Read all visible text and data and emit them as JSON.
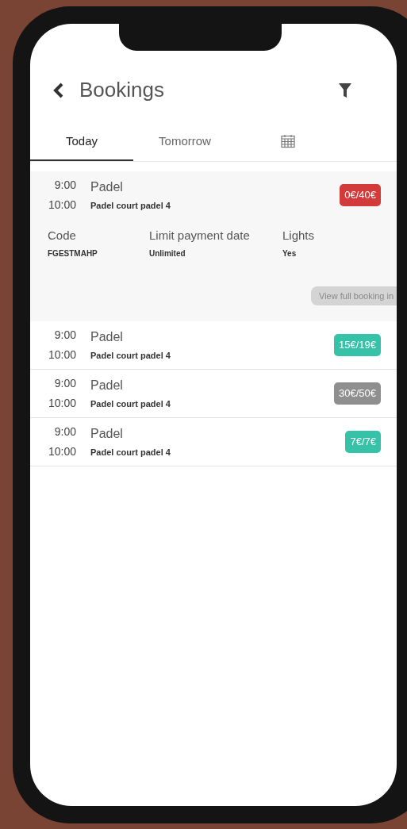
{
  "header": {
    "title": "Bookings"
  },
  "tabs": [
    {
      "kind": "text",
      "label": "Today",
      "selected": true
    },
    {
      "kind": "text",
      "label": "Tomorrow",
      "selected": false
    },
    {
      "kind": "calendar",
      "selected": false
    }
  ],
  "bookings": [
    {
      "start": "9:00",
      "end": "10:00",
      "sport": "Padel",
      "court": "Padel court padel 4",
      "price": "0€/40€",
      "color": "#d33a3a",
      "expanded": true,
      "details": [
        {
          "label": "Code",
          "value": "FGESTMAHP"
        },
        {
          "label": "Limit payment date",
          "value": "Unlimited"
        },
        {
          "label": "Lights",
          "value": "Yes"
        }
      ],
      "action": "View full booking in"
    },
    {
      "start": "9:00",
      "end": "10:00",
      "sport": "Padel",
      "court": "Padel court padel 4",
      "price": "15€/19€",
      "color": "#36c2a8",
      "expanded": false
    },
    {
      "start": "9:00",
      "end": "10:00",
      "sport": "Padel",
      "court": "Padel court padel 4",
      "price": "30€/50€",
      "color": "#8f8f8f",
      "expanded": false
    },
    {
      "start": "9:00",
      "end": "10:00",
      "sport": "Padel",
      "court": "Padel court padel 4",
      "price": "7€/7€",
      "color": "#36c2a8",
      "expanded": false
    }
  ]
}
